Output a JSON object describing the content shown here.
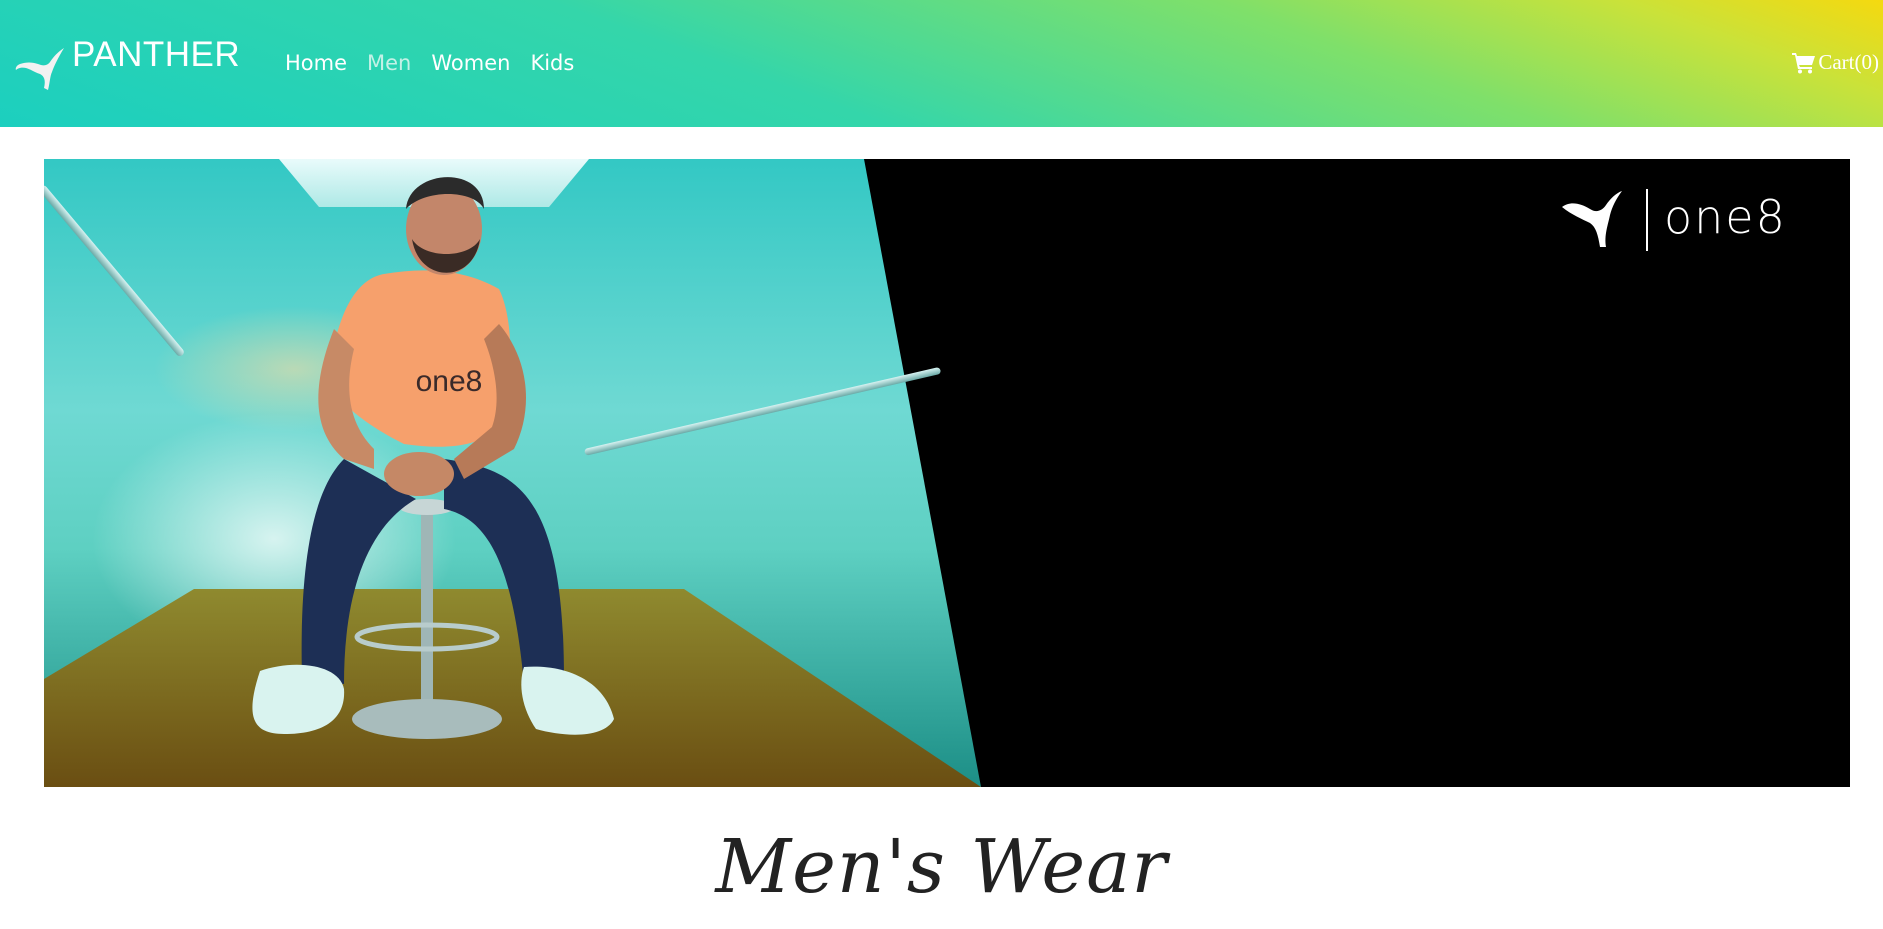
{
  "navbar": {
    "brand_name": "PANTHER",
    "brand_icon": "panther-logo-icon",
    "links": [
      {
        "label": "Home",
        "active": false
      },
      {
        "label": "Men",
        "active": true
      },
      {
        "label": "Women",
        "active": false
      },
      {
        "label": "Kids",
        "active": false
      }
    ],
    "cart_label": "Cart(0)",
    "cart_icon": "shopping-cart-icon"
  },
  "banner": {
    "logo_text": "one8",
    "shirt_text": "one8"
  },
  "section": {
    "title": "Men's Wear"
  },
  "colors": {
    "nav_gradient_start": "#1ccfbf",
    "nav_gradient_mid": "#7fe06a",
    "nav_gradient_end": "#f5d90f",
    "banner_bg": "#000000",
    "title_color": "#222222"
  }
}
